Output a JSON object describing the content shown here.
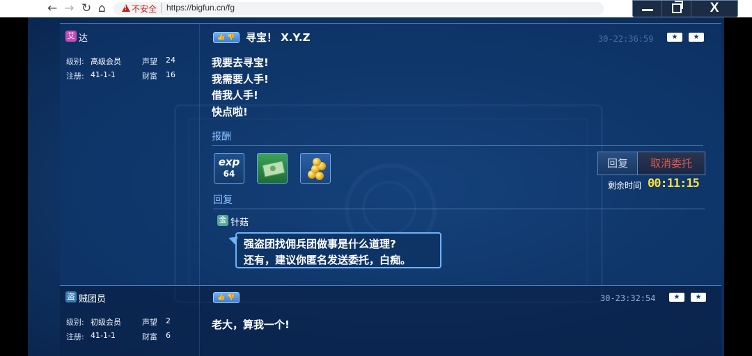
{
  "browser": {
    "back": "←",
    "forward": "→",
    "reload": "↻",
    "home": "⌂",
    "security_label": "不安全",
    "url": "https://bigfun.cn/fg"
  },
  "window_controls": {
    "close": "X"
  },
  "posts": [
    {
      "role_badge": "艾",
      "role_color": "#c44ab5",
      "username": "达",
      "level_label": "级别:",
      "level_value": "高级会员",
      "reputation_label": "声望",
      "reputation_value": "24",
      "register_label": "注册:",
      "register_value": "41-1-1",
      "wealth_label": "财富",
      "wealth_value": "16",
      "title": "寻宝！ X.Y.Z",
      "timestamp": "30-22:36:59",
      "body": [
        "我要去寻宝!",
        "我需要人手!",
        "借我人手!",
        "快点啦!"
      ],
      "reward_label": "报酬",
      "rewards": [
        {
          "icon": "exp-icon",
          "word": "exp",
          "value": "64"
        },
        {
          "icon": "money-icon"
        },
        {
          "icon": "gold-coins-icon"
        }
      ],
      "reply_button": "回复",
      "cancel_button": "取消委托",
      "remaining_label": "剩余时间",
      "remaining_time": "00:11:15",
      "replies_label": "回复",
      "reply": {
        "badge": "金",
        "badge_color": "#5aa79a",
        "username": "针菇",
        "lines": [
          "强盗团找佣兵团做事是什么道理?",
          "还有，建议你匿名发送委托，白痴。"
        ]
      }
    },
    {
      "role_badge": "盗",
      "role_color": "#3a7fb5",
      "username": "贼团员",
      "level_label": "级别:",
      "level_value": "初级会员",
      "reputation_label": "声望",
      "reputation_value": "2",
      "register_label": "注册:",
      "register_value": "41-1-1",
      "wealth_label": "财富",
      "wealth_value": "6",
      "timestamp": "30-23:32:54",
      "body": [
        "老大，算我一个!"
      ]
    }
  ],
  "colors": {
    "accent_blue": "#6fb2f5",
    "timer_yellow": "#ffe03a",
    "cancel_red": "#e2584b"
  }
}
